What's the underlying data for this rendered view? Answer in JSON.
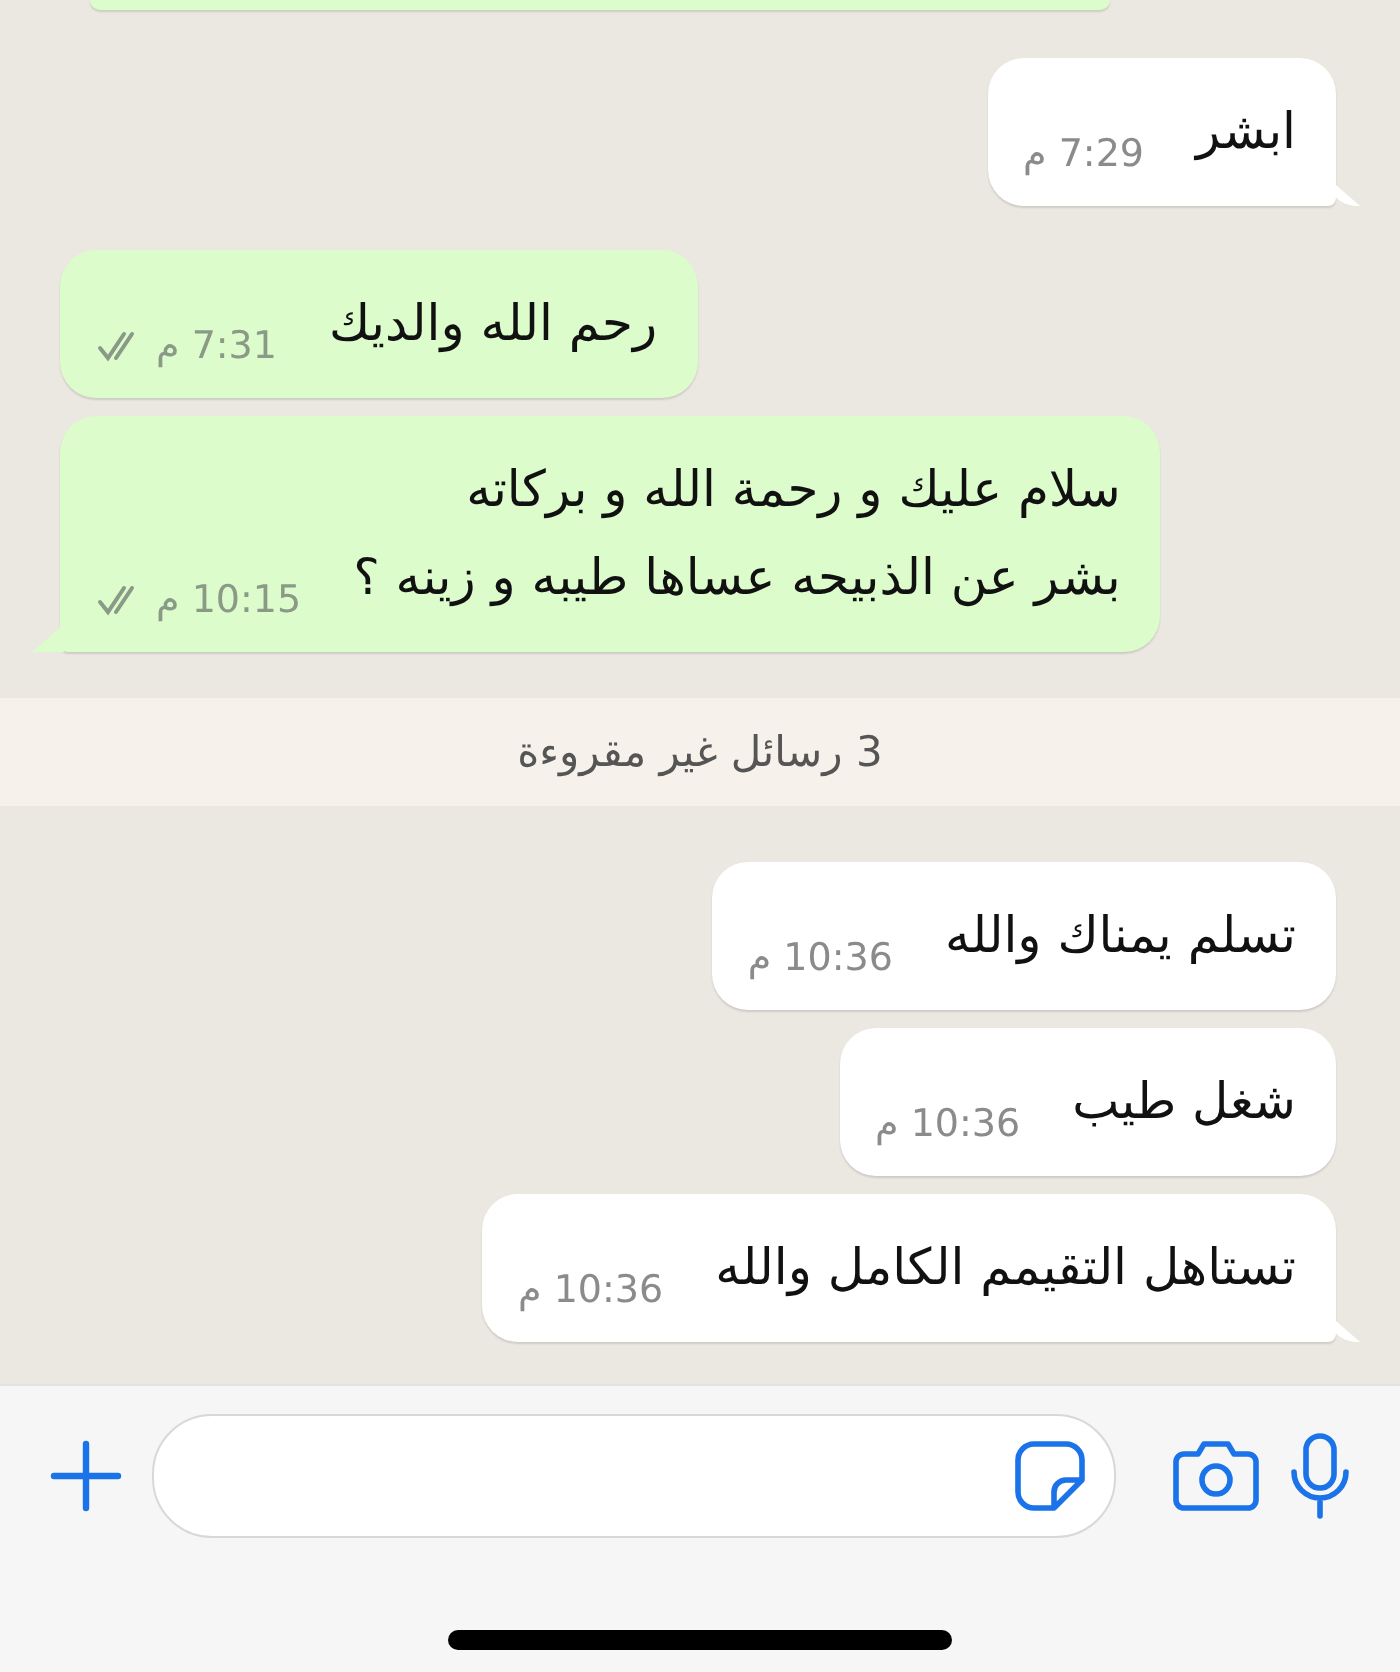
{
  "messages": [
    {
      "kind": "outgoing",
      "partial": true,
      "tail": false
    },
    {
      "kind": "incoming",
      "text": "ابشر",
      "time": "7:29 م",
      "tail": true
    },
    {
      "kind": "outgoing",
      "text": "رحم الله والديك",
      "time": "7:31 م",
      "read": false,
      "tail": false
    },
    {
      "kind": "outgoing",
      "text": "سلام عليك و رحمة الله و بركاته\nبشر عن الذبيحه عساها طيبه و زينه ؟",
      "time": "10:15 م",
      "read": false,
      "tail": true
    },
    {
      "kind": "banner",
      "text": "3 رسائل غير مقروءة"
    },
    {
      "kind": "incoming",
      "text": "تسلم يمناك والله",
      "time": "10:36 م",
      "tail": false
    },
    {
      "kind": "incoming",
      "text": "شغل طيب",
      "time": "10:36 م",
      "tail": false
    },
    {
      "kind": "incoming",
      "text": "تستاهل التقيمم الكامل والله",
      "time": "10:36 م",
      "tail": true
    }
  ]
}
